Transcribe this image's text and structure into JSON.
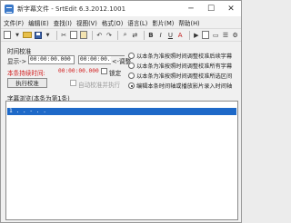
{
  "window": {
    "title": "新字幕文件 - SrtEdit 6.3.2012.1001",
    "min": "─",
    "max": "☐",
    "close": "✕"
  },
  "menu": [
    "文件(F)",
    "编辑(E)",
    "查找(I)",
    "视图(V)",
    "格式(O)",
    "语言(L)",
    "影片(M)",
    "帮助(H)"
  ],
  "toolbar": {
    "undo": "↶",
    "redo": "↷",
    "bold": "B",
    "italic": "I",
    "underline": "U",
    "text_color": "A"
  },
  "timing": {
    "group_label": "时间校准",
    "display_label": "显示->",
    "start_time": "00:00:00.000",
    "end_time": "00:00:00.000",
    "adjust_label": "<-调整",
    "duration_label": "本条持续时间:",
    "duration_value": "00:00:00.000",
    "lock_label": "锁定",
    "execute_button": "执行校准",
    "auto_execute_label": "自动校准并执行"
  },
  "options": [
    {
      "label": "以本条为准按照时间调整校准后续字幕",
      "selected": false
    },
    {
      "label": "以本条为准按照时间调整校准所有字幕",
      "selected": false
    },
    {
      "label": "以本条为准按照时间调整校准所选区间",
      "selected": false
    },
    {
      "label": "编辑本条时间轴或播放影片录入时间轴",
      "selected": true
    }
  ],
  "preview": {
    "label": "字幕浏览(本条为第1条)",
    "selected_line": "1 .  .  -  .  ."
  }
}
